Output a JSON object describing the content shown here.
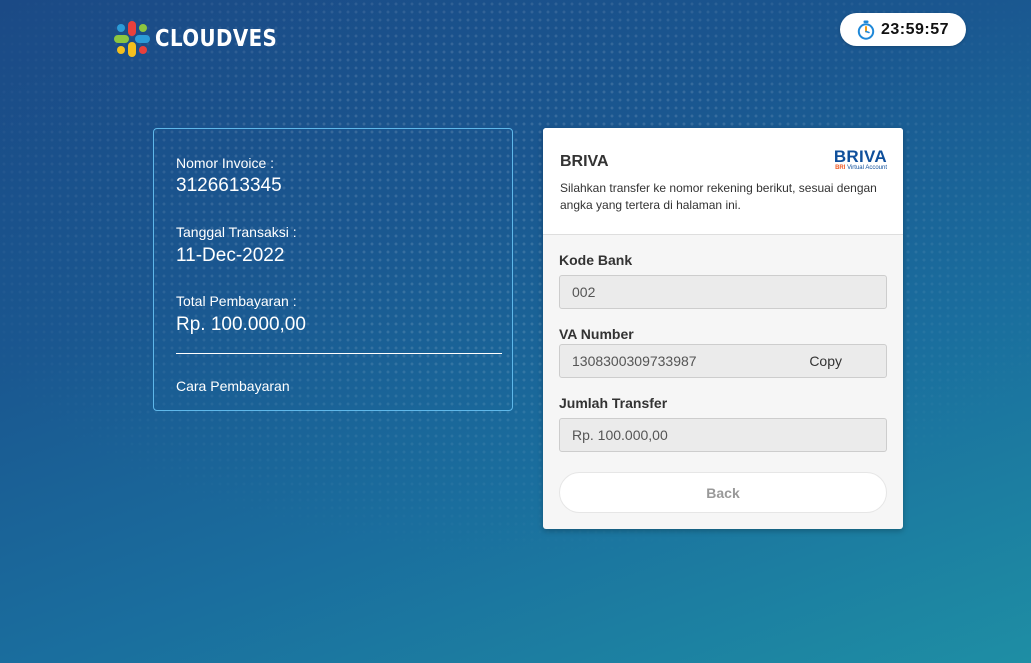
{
  "header": {
    "logo_text": "CLOUDVES",
    "timer": "23:59:57"
  },
  "invoice": {
    "number_label": "Nomor Invoice :",
    "number_value": "3126613345",
    "date_label": "Tanggal Transaksi :",
    "date_value": "11-Dec-2022",
    "total_label": "Total Pembayaran :",
    "total_value": "Rp. 100.000,00",
    "how_to_pay_label": "Cara Pembayaran"
  },
  "payment": {
    "method_title": "BRIVA",
    "brand_logo": {
      "main": "BRIVA",
      "sub_prefix": "BRI",
      "sub_suffix": "Virtual Account"
    },
    "description": "Silahkan transfer ke nomor rekening berikut, sesuai dengan angka yang tertera di halaman ini.",
    "bank_code_label": "Kode Bank",
    "bank_code_value": "002",
    "va_label": "VA Number",
    "va_value": "1308300309733987",
    "copy_label": "Copy",
    "amount_label": "Jumlah Transfer",
    "amount_value": "Rp. 100.000,00",
    "back_label": "Back"
  },
  "icons": {
    "timer": "stopwatch-icon",
    "logo": "cloudves-logo-icon"
  },
  "colors": {
    "background_start": "#1b4a86",
    "background_end": "#1e8ea4",
    "card_border": "#5fb8ea",
    "briva_blue": "#0f4f9b",
    "bri_orange": "#f15a24"
  }
}
